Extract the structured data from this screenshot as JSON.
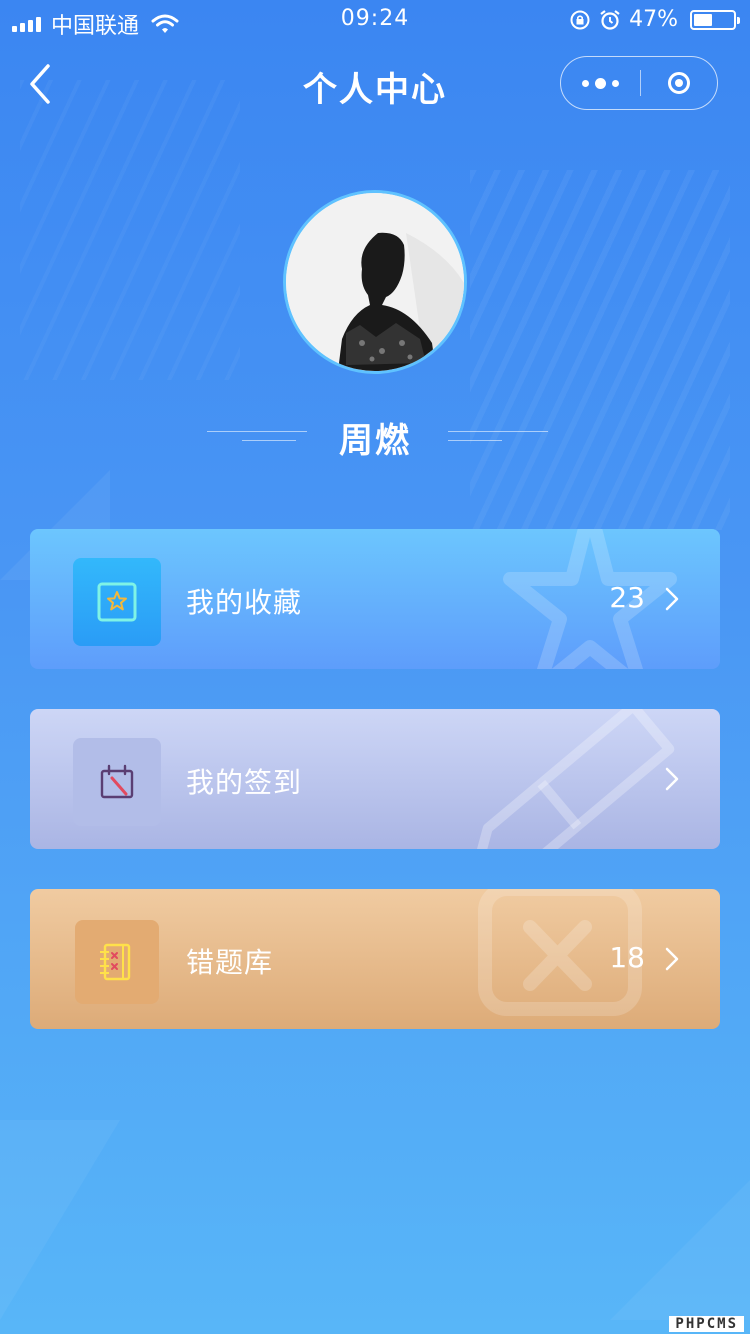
{
  "status_bar": {
    "carrier": "中国联通",
    "time": "09:24",
    "battery_percent": "47%",
    "battery_level": 0.47
  },
  "nav": {
    "title": "个人中心",
    "icons": [
      "back-arrow-icon",
      "more-icon",
      "close-mini-program-icon"
    ]
  },
  "profile": {
    "name": "周燃"
  },
  "menu": [
    {
      "label": "我的收藏",
      "count": "23",
      "icon": "favorite-star-icon",
      "color": "#5e9dfb"
    },
    {
      "label": "我的签到",
      "count": "",
      "icon": "calendar-sign-in-icon",
      "color": "#aab5e4"
    },
    {
      "label": "错题库",
      "count": "18",
      "icon": "wrong-questions-book-icon",
      "color": "#ddab78"
    }
  ],
  "watermark": "PHPCMS",
  "colors": {
    "background_top": "#3b86f2",
    "background_bottom": "#58b6f8",
    "avatar_border": "#5fc2ff"
  }
}
